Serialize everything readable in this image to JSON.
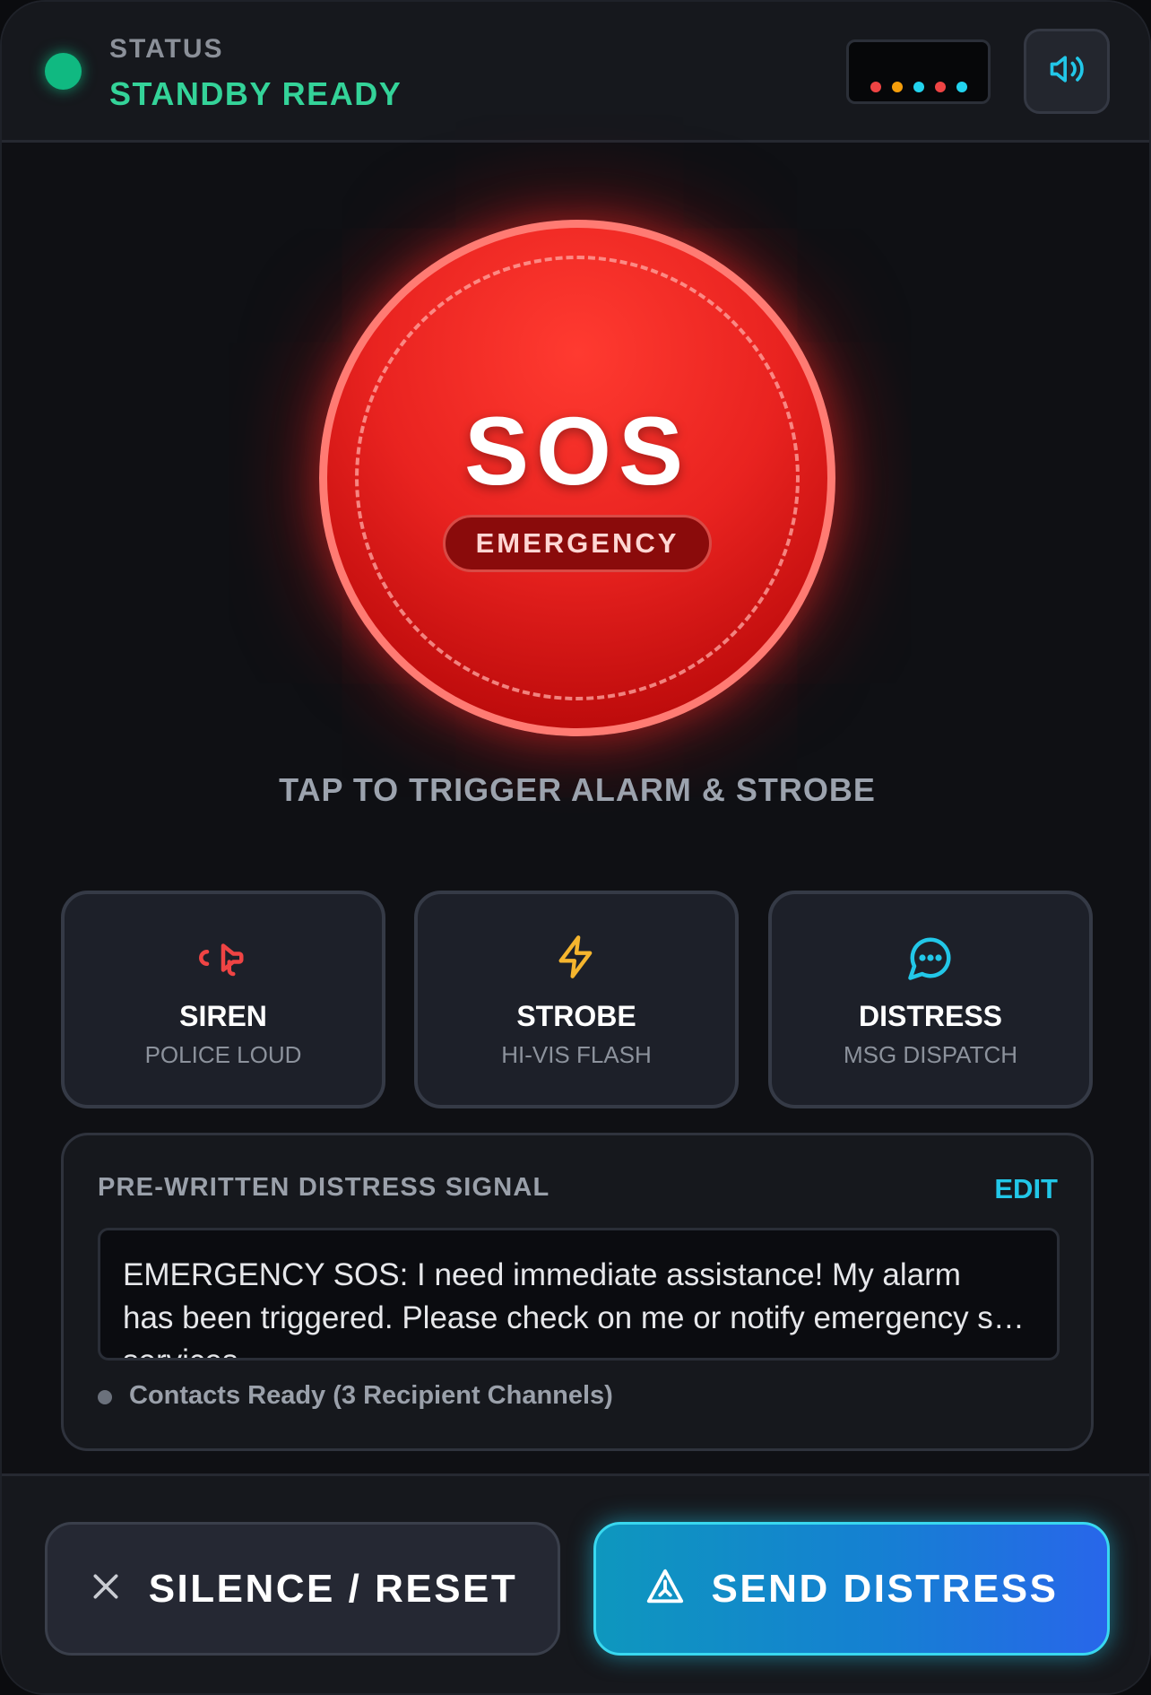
{
  "header": {
    "status_label": "STATUS",
    "status_value": "STANDBY READY",
    "status_color": "#10b981",
    "led_colors": [
      "#ef4444",
      "#f59e0b",
      "#22d3ee",
      "#ef4444",
      "#22d3ee"
    ],
    "sound_icon": "speaker-volume-icon"
  },
  "sos": {
    "label": "SOS",
    "sublabel": "EMERGENCY",
    "hint": "TAP TO TRIGGER ALARM & STROBE",
    "color": "#e92320"
  },
  "modes": [
    {
      "title": "SIREN",
      "subtitle": "POLICE LOUD",
      "icon": "megaphone-icon",
      "color": "#ef4444"
    },
    {
      "title": "STROBE",
      "subtitle": "HI-VIS FLASH",
      "icon": "lightning-icon",
      "color": "#f5b52e"
    },
    {
      "title": "DISTRESS",
      "subtitle": "MSG DISPATCH",
      "icon": "chat-bubble-icon",
      "color": "#22c7e8"
    }
  ],
  "message": {
    "heading": "PRE-WRITTEN DISTRESS SIGNAL",
    "edit_label": "EDIT",
    "line1": "EMERGENCY SOS: I need immediate assistance! My alarm",
    "line2": "has been triggered. Please check on me or notify emergency services.",
    "line3": "services",
    "contacts": "Contacts Ready (3 Recipient Channels)"
  },
  "footer": {
    "reset_label": "SILENCE / RESET",
    "send_label": "SEND DISTRESS",
    "accent": "#22c7e8"
  }
}
